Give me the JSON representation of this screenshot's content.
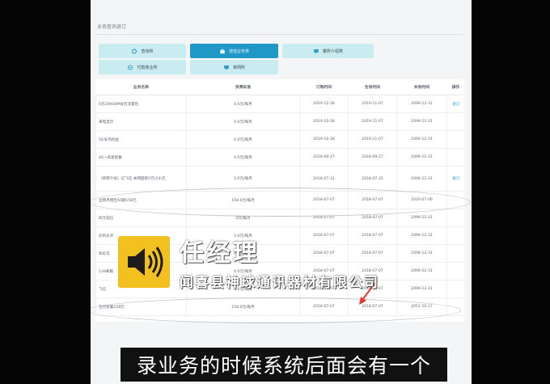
{
  "page": {
    "section_title": "业务查询退订"
  },
  "tiles": [
    {
      "label": "查询所",
      "style": "light",
      "icon": "circle-icon"
    },
    {
      "label": "增值业务类",
      "style": "dark",
      "icon": "briefcase-icon"
    },
    {
      "label": "着所介绍类",
      "style": "light",
      "icon": "chat-icon"
    },
    {
      "label": "付款账业所",
      "style": "light",
      "icon": "globe-icon"
    },
    {
      "label": "家网所",
      "style": "light",
      "icon": "monitor-icon"
    }
  ],
  "table": {
    "headers": [
      "业务名称",
      "资费标准",
      "订购时间",
      "生效时间",
      "失效时间",
      "操作"
    ],
    "rows": [
      {
        "name": "6元20000M省内流量包",
        "fee": "0.0元/每月",
        "order": "2019-12-28",
        "start": "2019-11-07",
        "end": "2099-12-31",
        "op": "退订"
      },
      {
        "name": "来电显示",
        "fee": "0.0元/每月",
        "order": "2019-10-28",
        "start": "2019-11-07",
        "end": "2099-12-31",
        "op": ""
      },
      {
        "name": "5G早鸟权益",
        "fee": "0.0元/每月",
        "order": "2019-10-28",
        "start": "2019-11-07",
        "end": "2099-12-31",
        "op": ""
      },
      {
        "name": "4G+高速套餐",
        "fee": "0.0元/每月",
        "order": "2018-09-27",
        "start": "2018-09-27",
        "end": "2099-12-31",
        "op": ""
      },
      {
        "name": "（新转介绍）幻飞信·本网国际5元(24)元",
        "fee": "5.0元/每月",
        "order": "2018-07-31",
        "start": "2018-07-31",
        "end": "2099-12-31",
        "op": "退订"
      },
      {
        "name": "全网月租包50期158元",
        "fee": "158.0元/每月",
        "order": "2018-07-07",
        "start": "2018-07-07",
        "end": "2020-07-06",
        "op": ""
      },
      {
        "name": "四元短信",
        "fee": "0元/每月",
        "order": "2018-07-07",
        "start": "2018-07-07",
        "end": "2099-12-31",
        "op": ""
      },
      {
        "name": "彩铃乐享",
        "fee": "0.0元/每月",
        "order": "2018-07-07",
        "start": "2018-07-07",
        "end": "2099-12-31",
        "op": ""
      },
      {
        "name": "和彩云",
        "fee": "0.0元/每月",
        "order": "2018-07-07",
        "start": "2018-07-07",
        "end": "2099-12-31",
        "op": ""
      },
      {
        "name": "139邮箱",
        "fee": "0.0元/每月",
        "order": "2018-07-07",
        "start": "2018-07-07",
        "end": "2099-12-31",
        "op": ""
      },
      {
        "name": "飞信",
        "fee": "0.0元/每月",
        "order": "2018-07-07",
        "start": "2018-07-07",
        "end": "2099-12-31",
        "op": ""
      },
      {
        "name": "包月套餐158元",
        "fee": "158.0元/每月",
        "order": "2018-07-07",
        "start": "2018-07-07",
        "end": "2051-10-17",
        "op": ""
      }
    ]
  },
  "overlay": {
    "speaker_icon": "speaker-icon",
    "name_caption": "任经理",
    "company_caption": "闻喜县神球通讯器材有限公司",
    "subtitle": "录业务的时候系统后面会有一个"
  },
  "colors": {
    "accent": "#1f97c7",
    "tile_light": "#c9ecf1",
    "speaker_bg": "#f2c11f",
    "arrow": "#e03a2e"
  }
}
